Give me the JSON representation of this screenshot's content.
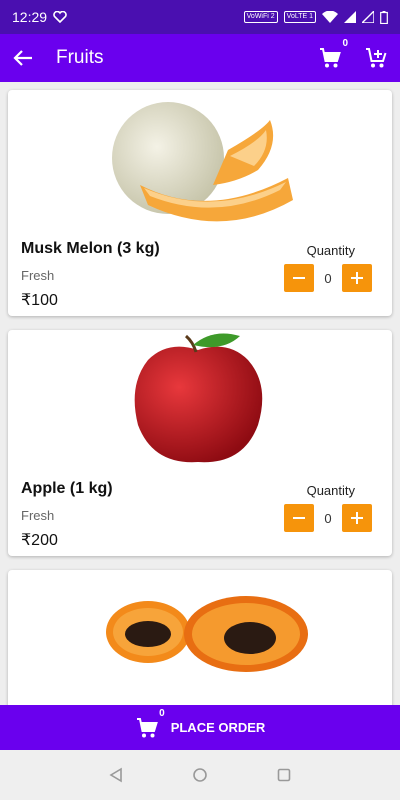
{
  "status_bar": {
    "time": "12:29",
    "wifi_badge": "VoWiFi 2",
    "lte_badge": "VoLTE 1"
  },
  "app_bar": {
    "title": "Fruits",
    "cart_count": "0"
  },
  "products": [
    {
      "name": "Musk Melon (3 kg)",
      "type": "Fresh",
      "price": "₹100",
      "quantity_label": "Quantity",
      "quantity": "0",
      "image": "musk-melon"
    },
    {
      "name": "Apple (1 kg)",
      "type": "Fresh",
      "price": "₹200",
      "quantity_label": "Quantity",
      "quantity": "0",
      "image": "apple"
    },
    {
      "name": "",
      "type": "",
      "price": "",
      "quantity_label": "",
      "quantity": "",
      "image": "papaya"
    }
  ],
  "bottom_bar": {
    "label": "PLACE ORDER",
    "cart_count": "0"
  },
  "colors": {
    "status": "#4a0fb0",
    "primary": "#6a00ee",
    "accent": "#f6940b"
  },
  "icons": [
    "back-arrow-icon",
    "cart-icon",
    "add-cart-icon",
    "minus-icon",
    "plus-icon",
    "back-nav-icon",
    "home-nav-icon",
    "recents-nav-icon"
  ]
}
